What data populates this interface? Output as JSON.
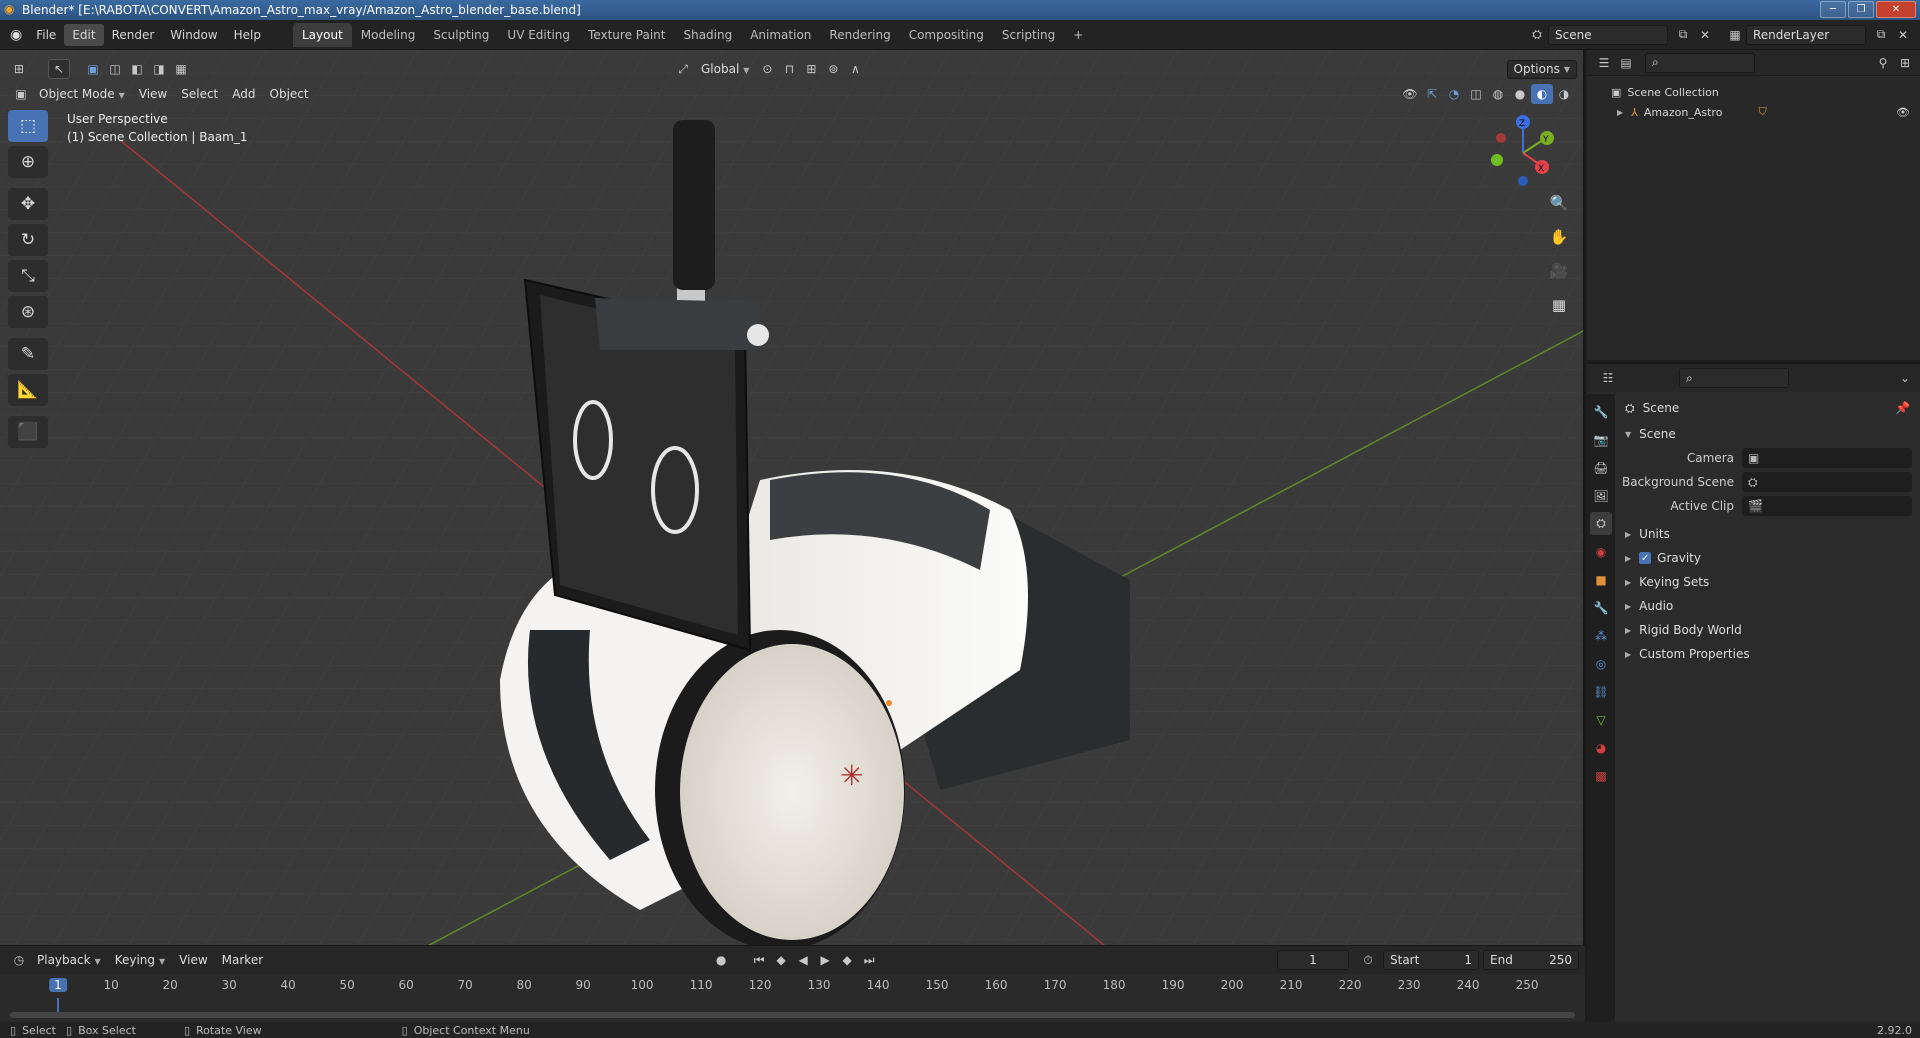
{
  "window": {
    "title": "Blender* [E:\\RABOTA\\CONVERT\\Amazon_Astro_max_vray/Amazon_Astro_blender_base.blend]"
  },
  "menu": [
    "File",
    "Edit",
    "Render",
    "Window",
    "Help"
  ],
  "workspaces": [
    "Layout",
    "Modeling",
    "Sculpting",
    "UV Editing",
    "Texture Paint",
    "Shading",
    "Animation",
    "Rendering",
    "Compositing",
    "Scripting",
    "+"
  ],
  "scene_selector": "Scene",
  "render_layer": "RenderLayer",
  "viewport": {
    "mode": "Object Mode",
    "menus": [
      "View",
      "Select",
      "Add",
      "Object"
    ],
    "transform_orientation": "Global",
    "options_label": "Options",
    "info_line1": "User Perspective",
    "info_line2": "(1) Scene Collection | Baam_1"
  },
  "gizmo": {
    "z": "Z",
    "y": "Y",
    "x": "X"
  },
  "timeline": {
    "menus": [
      "Playback",
      "Keying",
      "View",
      "Marker"
    ],
    "current_frame": "1",
    "start_label": "Start",
    "start": "1",
    "end_label": "End",
    "end": "250",
    "ticks": [
      "1",
      "10",
      "20",
      "30",
      "40",
      "50",
      "60",
      "70",
      "80",
      "90",
      "100",
      "110",
      "120",
      "130",
      "140",
      "150",
      "160",
      "170",
      "180",
      "190",
      "200",
      "210",
      "220",
      "230",
      "240",
      "250"
    ]
  },
  "outliner": {
    "root": "Scene Collection",
    "items": [
      "Amazon_Astro"
    ]
  },
  "properties": {
    "context": "Scene",
    "panel_title": "Scene",
    "camera_label": "Camera",
    "background_scene_label": "Background Scene",
    "active_clip_label": "Active Clip",
    "sections": [
      "Units",
      "Gravity",
      "Keying Sets",
      "Audio",
      "Rigid Body World",
      "Custom Properties"
    ]
  },
  "status": {
    "select": "Select",
    "box_select": "Box Select",
    "rotate_view": "Rotate View",
    "context_menu": "Object Context Menu",
    "version": "2.92.0"
  },
  "colors": {
    "accent": "#4772b3",
    "viewport_bg": "#3a3a3a",
    "axis_x": "#c03a3a",
    "axis_y": "#6a9a2a"
  }
}
